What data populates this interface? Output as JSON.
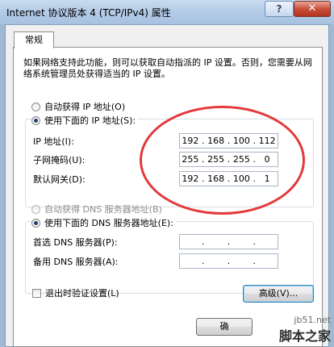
{
  "window": {
    "title": "Internet 协议版本 4 (TCP/IPv4) 属性",
    "help_glyph": "?",
    "close_glyph": "✕"
  },
  "tabs": [
    {
      "label": "常规",
      "selected": true
    }
  ],
  "description": "如果网络支持此功能，则可以获取自动指派的 IP 设置。否则，您需要从网络系统管理员处获得适当的 IP 设置。",
  "ip_section": {
    "auto_label": "自动获得 IP 地址(O)",
    "manual_label": "使用下面的 IP 地址(S):",
    "selected": "manual",
    "fields": [
      {
        "label": "IP 地址(I):",
        "octets": [
          "192",
          "168",
          "100",
          "112"
        ]
      },
      {
        "label": "子网掩码(U):",
        "octets": [
          "255",
          "255",
          "255",
          "0"
        ]
      },
      {
        "label": "默认网关(D):",
        "octets": [
          "192",
          "168",
          "100",
          "1"
        ]
      }
    ]
  },
  "dns_section": {
    "auto_label": "自动获得 DNS 服务器地址(B)",
    "manual_label": "使用下面的 DNS 服务器地址(E):",
    "selected": "manual",
    "auto_disabled": true,
    "fields": [
      {
        "label": "首选 DNS 服务器(P):",
        "octets": [
          "",
          "",
          "",
          ""
        ]
      },
      {
        "label": "备用 DNS 服务器(A):",
        "octets": [
          "",
          "",
          "",
          ""
        ]
      }
    ]
  },
  "validate_on_exit": {
    "label": "退出时验证设置(L)",
    "checked": false
  },
  "buttons": {
    "advanced": "高级(V)...",
    "ok": "确"
  },
  "annotation": {
    "shape": "ellipse",
    "color": "#e3393b"
  },
  "watermark": {
    "url": "jb51.net",
    "name": "脚本之家"
  }
}
